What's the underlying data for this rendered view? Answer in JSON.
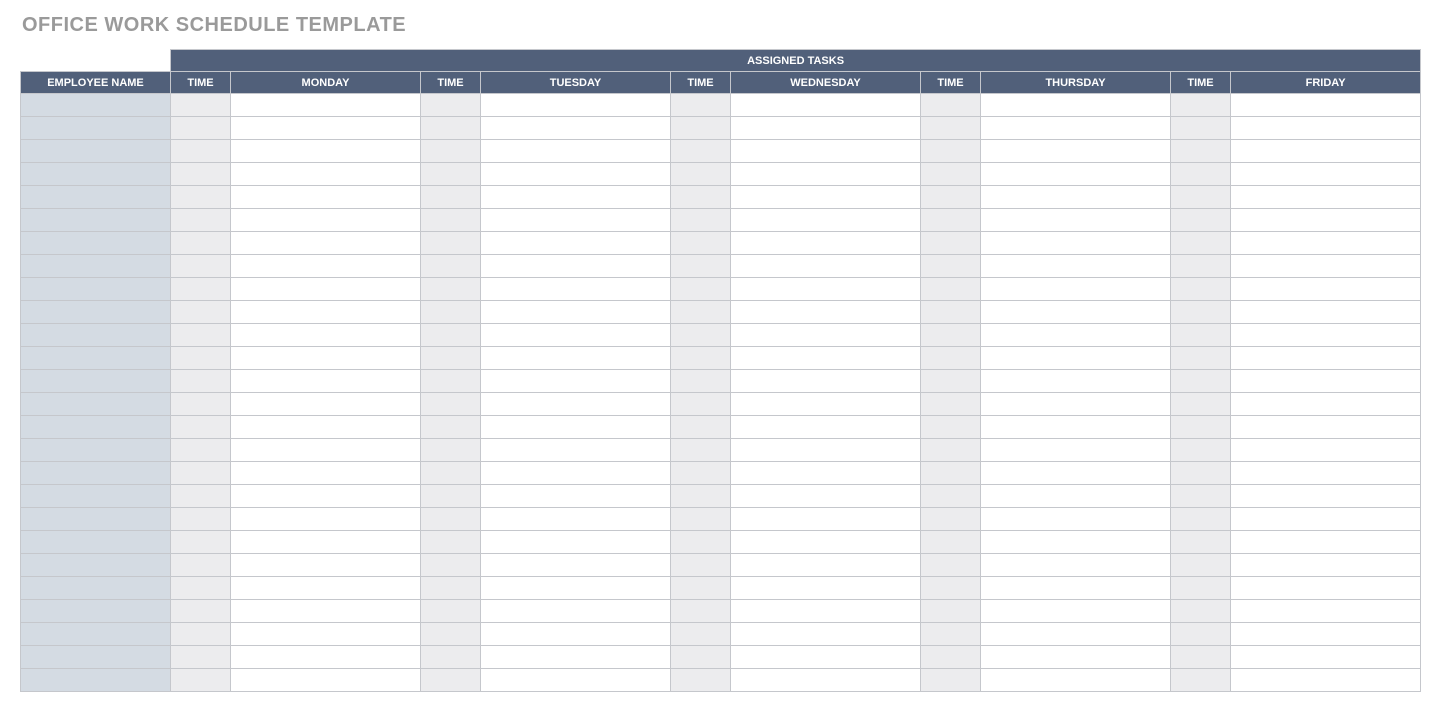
{
  "title": "OFFICE WORK SCHEDULE TEMPLATE",
  "header": {
    "employee": "EMPLOYEE NAME",
    "assigned": "ASSIGNED TASKS",
    "time": "TIME",
    "days": [
      "MONDAY",
      "TUESDAY",
      "WEDNESDAY",
      "THURSDAY",
      "FRIDAY"
    ]
  },
  "rows": 26
}
